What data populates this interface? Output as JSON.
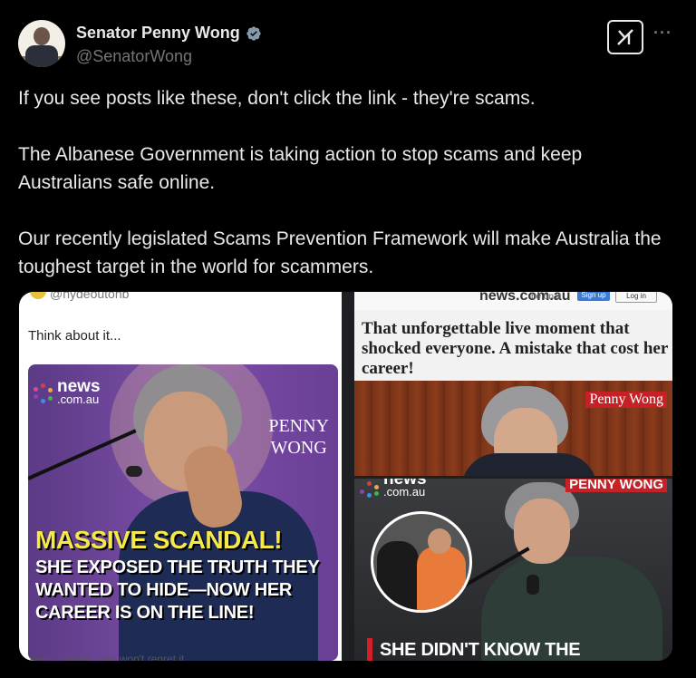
{
  "author": {
    "display_name": "Senator Penny Wong",
    "handle": "@SenatorWong",
    "verified_icon": "verified-badge-icon",
    "avatar_icon": "profile-avatar"
  },
  "actions": {
    "grok_icon": "grok-icon",
    "more_label": "···"
  },
  "tweet": {
    "paragraphs": [
      "If you see posts like these, don't click the link - they're scams.",
      "The Albanese Government is taking action to stop scams and keep Australians safe online.",
      "Our recently legislated Scams Prevention Framework will make Australia the toughest target in the world for scammers."
    ]
  },
  "media": {
    "left": {
      "handle": "@hydeoutohb",
      "caption": "Think about it...",
      "news_logo_main": "news",
      "news_logo_sub": ".com.au",
      "name_overlay_line1": "PENNY",
      "name_overlay_line2": "WONG",
      "scandal_title": "MASSIVE SCANDAL!",
      "scandal_body": "SHE EXPOSED THE TRUTH THEY WANTED TO HIDE—NOW HER CAREER IS ON THE LINE!",
      "footer": "keep reading, you won't regret it"
    },
    "right_top": {
      "logo": "news.com.au",
      "logo_sub": "be on it",
      "signup": "Sign up",
      "login": "Log in",
      "headline": "That unforgettable live moment that shocked everyone. A mistake that cost her career!",
      "name_tag": "Penny Wong"
    },
    "right_bottom": {
      "news_logo_main": "news",
      "news_logo_sub": ".com.au",
      "name_tag": "PENNY WONG",
      "caption": "SHE DIDN'T KNOW THE"
    }
  },
  "colors": {
    "background": "#000000",
    "text": "#e7e9ea",
    "muted": "#71767b",
    "verified": "#829aab",
    "scandal_yellow": "#f5e94a",
    "news_red": "#c62127"
  }
}
